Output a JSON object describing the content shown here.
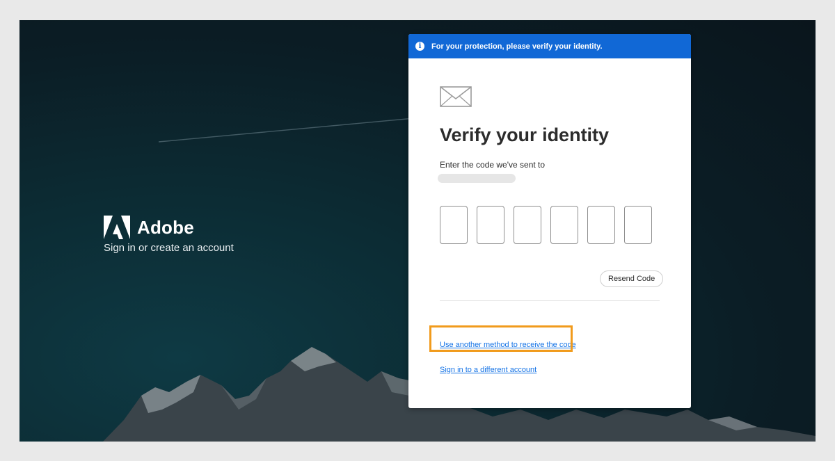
{
  "brand": {
    "name": "Adobe",
    "tagline": "Sign in or create an account",
    "logo_icon": "adobe-logo-icon"
  },
  "banner": {
    "icon": "info-icon",
    "text": "For your protection, please verify your identity."
  },
  "verify": {
    "icon": "envelope-icon",
    "title": "Verify your identity",
    "subtitle": "Enter the code we've sent to",
    "code_digits": [
      "",
      "",
      "",
      "",
      "",
      ""
    ],
    "resend_label": "Resend Code",
    "alt_method_link": "Use another method to receive the code",
    "switch_account_link": "Sign in to a different account"
  },
  "colors": {
    "banner": "#1168d6",
    "link": "#1473e6",
    "highlight": "#f19b1c"
  }
}
